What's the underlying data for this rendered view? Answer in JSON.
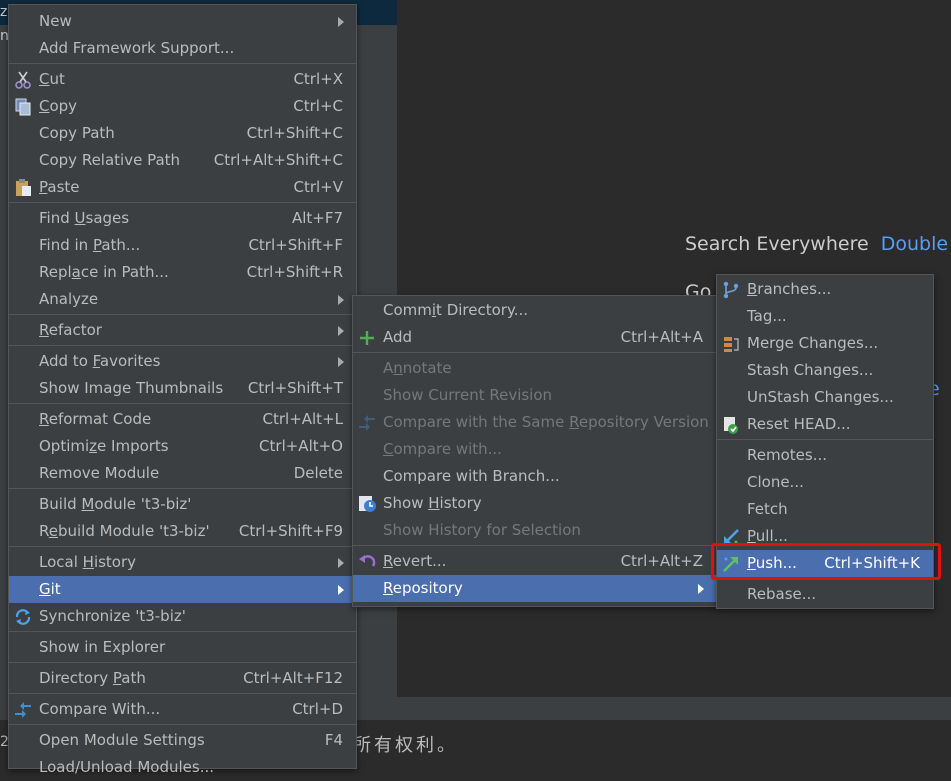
{
  "background": {
    "edge_chars": [
      "z",
      "n"
    ],
    "hint_search": "Search Everywhere",
    "hint_key": "Double",
    "hint_partial_go": "Go",
    "hint_partial_e": "e",
    "bottom_text": "所有权利。",
    "bottom_left": "2"
  },
  "main_menu": [
    {
      "label": "New",
      "submenu": true
    },
    {
      "label": "Add Framework Support..."
    },
    {
      "sep": true
    },
    {
      "label": "Cut",
      "shortcut": "Ctrl+X",
      "icon": "scissors-icon"
    },
    {
      "label": "Copy",
      "shortcut": "Ctrl+C",
      "icon": "copy-icon"
    },
    {
      "label": "Copy Path",
      "shortcut": "Ctrl+Shift+C"
    },
    {
      "label": "Copy Relative Path",
      "shortcut": "Ctrl+Alt+Shift+C"
    },
    {
      "label": "Paste",
      "shortcut": "Ctrl+V",
      "icon": "paste-icon"
    },
    {
      "sep": true
    },
    {
      "label": "Find Usages",
      "shortcut": "Alt+F7"
    },
    {
      "label": "Find in Path...",
      "shortcut": "Ctrl+Shift+F"
    },
    {
      "label": "Replace in Path...",
      "shortcut": "Ctrl+Shift+R"
    },
    {
      "label": "Analyze",
      "submenu": true
    },
    {
      "sep": true
    },
    {
      "label": "Refactor",
      "submenu": true
    },
    {
      "sep": true
    },
    {
      "label": "Add to Favorites",
      "submenu": true
    },
    {
      "label": "Show Image Thumbnails",
      "shortcut": "Ctrl+Shift+T"
    },
    {
      "sep": true
    },
    {
      "label": "Reformat Code",
      "shortcut": "Ctrl+Alt+L"
    },
    {
      "label": "Optimize Imports",
      "shortcut": "Ctrl+Alt+O"
    },
    {
      "label": "Remove Module",
      "shortcut": "Delete"
    },
    {
      "sep": true
    },
    {
      "label": "Build Module 't3-biz'"
    },
    {
      "label": "Rebuild Module 't3-biz'",
      "shortcut": "Ctrl+Shift+F9"
    },
    {
      "sep": true
    },
    {
      "label": "Local History",
      "submenu": true
    },
    {
      "label": "Git",
      "submenu": true,
      "selected": true
    },
    {
      "label": "Synchronize 't3-biz'",
      "icon": "sync-icon"
    },
    {
      "sep": true
    },
    {
      "label": "Show in Explorer"
    },
    {
      "sep": true
    },
    {
      "label": "Directory Path",
      "shortcut": "Ctrl+Alt+F12"
    },
    {
      "sep": true
    },
    {
      "label": "Compare With...",
      "shortcut": "Ctrl+D",
      "icon": "compare-icon"
    },
    {
      "sep": true
    },
    {
      "label": "Open Module Settings",
      "shortcut": "F4"
    },
    {
      "label": "Load/Unload Modules..."
    }
  ],
  "git_menu": [
    {
      "label": "Commit Directory..."
    },
    {
      "label": "Add",
      "shortcut": "Ctrl+Alt+A",
      "icon": "plus-icon"
    },
    {
      "sep": true
    },
    {
      "label": "Annotate",
      "disabled": true
    },
    {
      "label": "Show Current Revision",
      "disabled": true
    },
    {
      "label": "Compare with the Same Repository Version",
      "disabled": true,
      "icon": "compare-icon"
    },
    {
      "label": "Compare with...",
      "disabled": true
    },
    {
      "label": "Compare with Branch..."
    },
    {
      "label": "Show History",
      "icon": "history-icon"
    },
    {
      "label": "Show History for Selection",
      "disabled": true
    },
    {
      "sep": true
    },
    {
      "label": "Revert...",
      "shortcut": "Ctrl+Alt+Z",
      "icon": "revert-icon"
    },
    {
      "label": "Repository",
      "submenu": true,
      "selected": true
    }
  ],
  "repo_menu": [
    {
      "label": "Branches...",
      "icon": "branch-icon"
    },
    {
      "label": "Tag..."
    },
    {
      "label": "Merge Changes...",
      "icon": "merge-icon"
    },
    {
      "label": "Stash Changes..."
    },
    {
      "label": "UnStash Changes..."
    },
    {
      "label": "Reset HEAD...",
      "icon": "reset-icon"
    },
    {
      "sep": true
    },
    {
      "label": "Remotes..."
    },
    {
      "label": "Clone..."
    },
    {
      "label": "Fetch"
    },
    {
      "label": "Pull...",
      "icon": "pull-icon"
    },
    {
      "label": "Push...",
      "shortcut": "Ctrl+Shift+K",
      "icon": "push-icon",
      "selected": true
    },
    {
      "sep": true
    },
    {
      "label": "Rebase..."
    }
  ],
  "colors": {
    "menu_bg": "#3c3f41",
    "selected_bg": "#4b6eaf",
    "highlight_border": "#e01010",
    "link_blue": "#589df6"
  }
}
